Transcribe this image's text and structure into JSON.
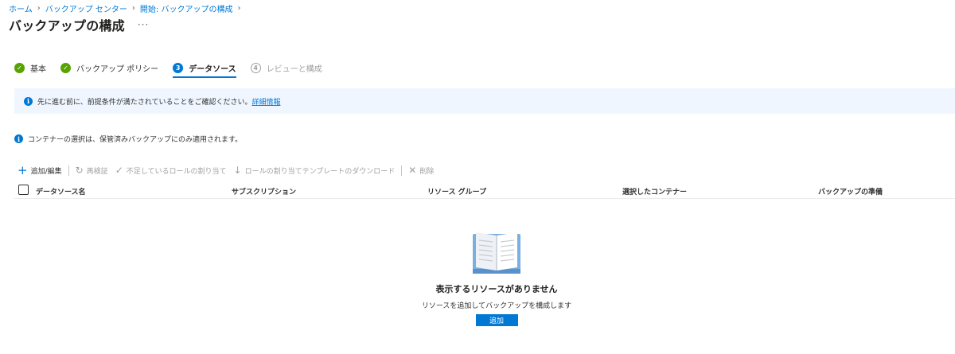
{
  "breadcrumb": [
    "ホーム",
    "バックアップ センター",
    "開始: バックアップの構成"
  ],
  "page_title": "バックアップの構成",
  "more_label": "···",
  "steps": [
    {
      "label": "基本",
      "state": "done",
      "marker": "✓"
    },
    {
      "label": "バックアップ ポリシー",
      "state": "done",
      "marker": "✓"
    },
    {
      "label": "データソース",
      "state": "current",
      "marker": "3"
    },
    {
      "label": "レビューと構成",
      "state": "future",
      "marker": "4"
    }
  ],
  "info_banner": {
    "icon": "info-icon",
    "text": "先に進む前に、前提条件が満たされていることをご確認ください。",
    "link": "詳細情報"
  },
  "info_line": {
    "icon": "info-icon",
    "text": "コンテナーの選択は、保管済みバックアップにのみ適用されます。"
  },
  "toolbar": {
    "add_edit": "追加/編集",
    "revalidate": "再検証",
    "assign_missing_roles": "不足しているロールの割り当て",
    "download_template": "ロールの割り当てテンプレートのダウンロード",
    "delete": "削除"
  },
  "table": {
    "columns": [
      "データソース名",
      "サブスクリプション",
      "リソース グループ",
      "選択したコンテナー",
      "バックアップの準備"
    ]
  },
  "empty_state": {
    "title": "表示するリソースがありません",
    "subtitle": "リソースを追加してバックアップを構成します",
    "button": "追加"
  },
  "colors": {
    "accent": "#0078d4",
    "success": "#57a300",
    "banner_bg": "#f0f6ff"
  }
}
